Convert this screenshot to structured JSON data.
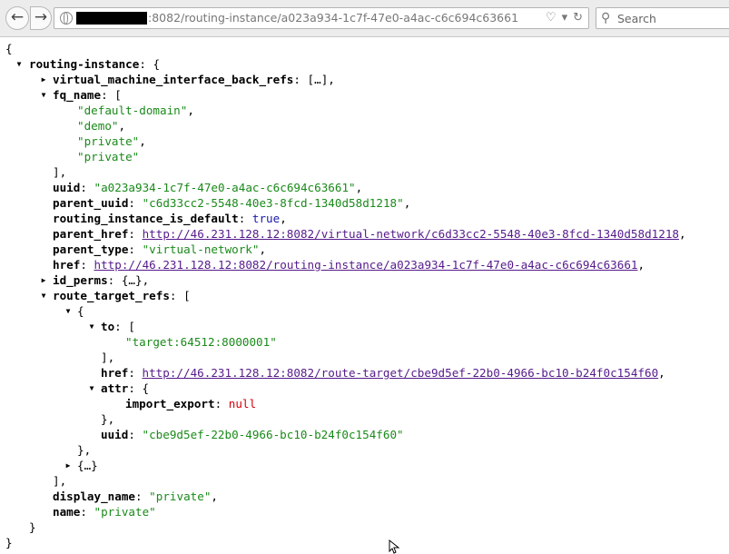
{
  "browser": {
    "back_glyph": "🡐",
    "forward_glyph": "🡒",
    "url_text": ":8082/routing-instance/a023a934-1c7f-47e0-a4ac-c6c694c63661",
    "url_icons": [
      "pocket-icon",
      "dropdown-icon",
      "reload-icon"
    ],
    "search_placeholder": "Search"
  },
  "json": {
    "open_root": "{",
    "close_root": "}",
    "routing_instance_key": "routing-instance",
    "vmi_key": "virtual_machine_interface_back_refs",
    "vmi_collapsed": "[…],",
    "fq_name_key": "fq_name",
    "fq_name_values": [
      "\"default-domain\"",
      "\"demo\"",
      "\"private\"",
      "\"private\""
    ],
    "close_bracket_comma": "],",
    "uuid_key": "uuid",
    "uuid_value": "\"a023a934-1c7f-47e0-a4ac-c6c694c63661\"",
    "parent_uuid_key": "parent_uuid",
    "parent_uuid_value": "\"c6d33cc2-5548-40e3-8fcd-1340d58d1218\"",
    "is_default_key": "routing_instance_is_default",
    "is_default_value": "true",
    "parent_href_key": "parent_href",
    "parent_href_value": "http://46.231.128.12:8082/virtual-network/c6d33cc2-5548-40e3-8fcd-1340d58d1218",
    "parent_type_key": "parent_type",
    "parent_type_value": "\"virtual-network\"",
    "href_key": "href",
    "href_value": "http://46.231.128.12:8082/routing-instance/a023a934-1c7f-47e0-a4ac-c6c694c63661",
    "id_perms_key": "id_perms",
    "id_perms_collapsed": "{…},",
    "route_target_refs_key": "route_target_refs",
    "to_key": "to",
    "to_value": "\"target:64512:8000001\"",
    "rt_href_value": "http://46.231.128.12:8082/route-target/cbe9d5ef-22b0-4966-bc10-b24f0c154f60",
    "attr_key": "attr",
    "import_export_key": "import_export",
    "import_export_value": "null",
    "rt_uuid_value": "\"cbe9d5ef-22b0-4966-bc10-b24f0c154f60\"",
    "second_ref_collapsed": "{…}",
    "display_name_key": "display_name",
    "display_name_value": "\"private\"",
    "name_key": "name",
    "name_value": "\"private\""
  }
}
